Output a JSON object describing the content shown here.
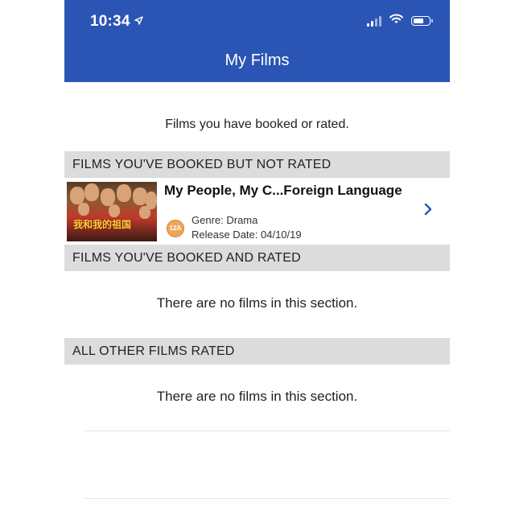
{
  "status_bar": {
    "time": "10:34"
  },
  "header": {
    "title": "My Films"
  },
  "intro_text": "Films you have booked or rated.",
  "sections": [
    {
      "title": "FILMS YOU'VE BOOKED BUT NOT RATED",
      "films": [
        {
          "title": "My People, My C...Foreign Language",
          "rating": "12A",
          "genre": "Genre: Drama",
          "release_date": "Release Date: 04/10/19",
          "poster_text": "我和我的祖国"
        }
      ]
    },
    {
      "title": "FILMS YOU'VE BOOKED AND RATED",
      "empty_message": "There are no films in this section."
    },
    {
      "title": "ALL OTHER FILMS RATED",
      "empty_message": "There are no films in this section."
    }
  ],
  "colors": {
    "header_bg": "#2a55b4",
    "section_bg": "#dcdcdc",
    "chevron": "#1f5fbf",
    "rating_badge": "#f0a55a"
  }
}
